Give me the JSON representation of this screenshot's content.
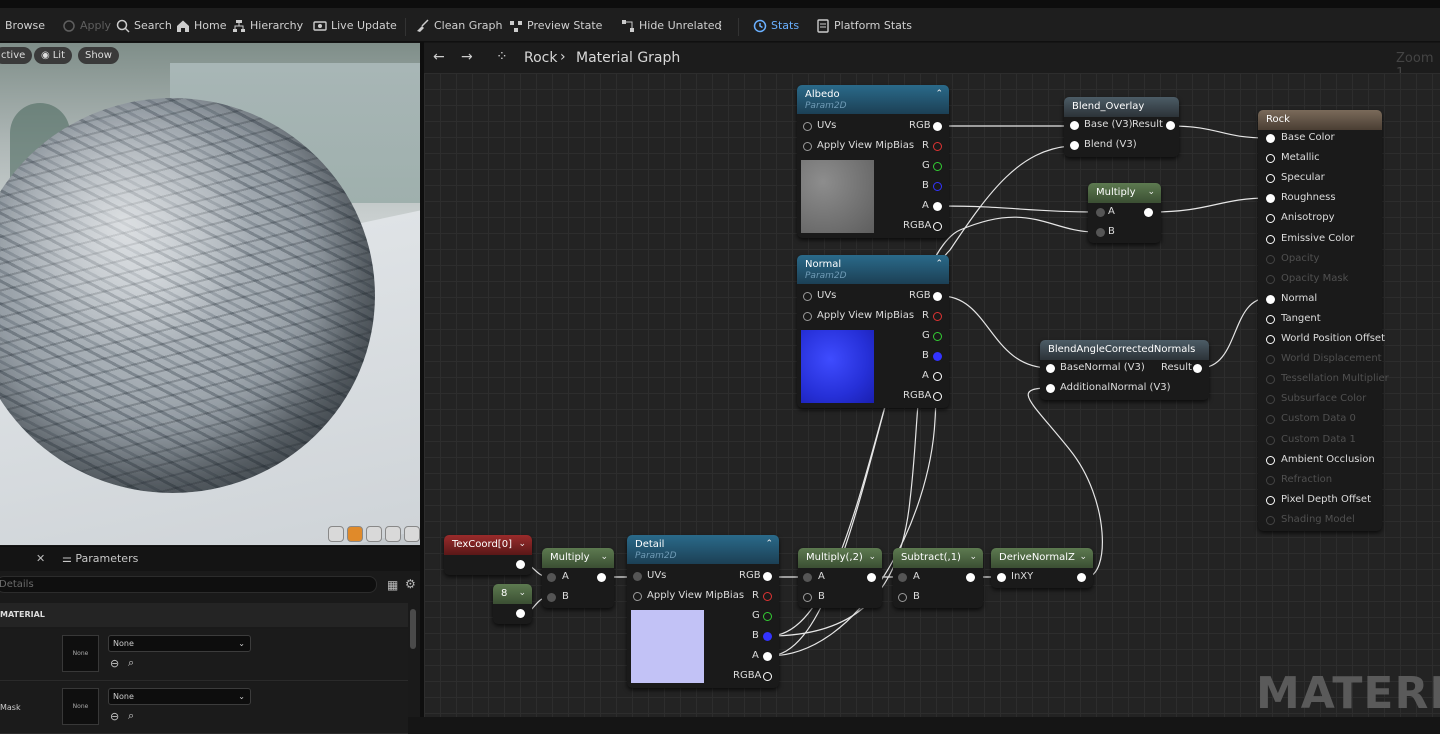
{
  "toolbar": {
    "items": [
      {
        "label": "Browse",
        "state": "normal"
      },
      {
        "label": "Apply",
        "state": "disabled"
      },
      {
        "label": "Search",
        "state": "normal"
      },
      {
        "label": "Home",
        "state": "normal"
      },
      {
        "label": "Hierarchy",
        "state": "normal"
      },
      {
        "label": "Live Update",
        "state": "normal"
      },
      {
        "label": "Clean Graph",
        "state": "normal"
      },
      {
        "label": "Preview State",
        "state": "normal"
      },
      {
        "label": "Hide Unrelated",
        "state": "normal"
      },
      {
        "label": "Stats",
        "state": "active"
      },
      {
        "label": "Platform Stats",
        "state": "normal"
      }
    ]
  },
  "viewport": {
    "chips": [
      "ctive",
      "Lit",
      "Show"
    ]
  },
  "details": {
    "tab_label": "Parameters",
    "search_placeholder": "Details",
    "category": "MATERIAL",
    "rows": [
      {
        "label": "",
        "thumb": "None",
        "value": "None"
      },
      {
        "label": "Mask",
        "thumb": "None",
        "value": "None"
      }
    ]
  },
  "graph": {
    "breadcrumb_root": "Rock",
    "breadcrumb_child": "Material Graph",
    "zoom_label": "Zoom 1",
    "watermark": "MATERIAL"
  },
  "nodes": {
    "albedo": {
      "title": "Albedo",
      "subtitle": "Param2D",
      "inputs": [
        "UVs",
        "Apply View MipBias"
      ],
      "outputs": [
        "RGB",
        "R",
        "G",
        "B",
        "A",
        "RGBA"
      ]
    },
    "normal": {
      "title": "Normal",
      "subtitle": "Param2D",
      "inputs": [
        "UVs",
        "Apply View MipBias"
      ],
      "outputs": [
        "RGB",
        "R",
        "G",
        "B",
        "A",
        "RGBA"
      ]
    },
    "detail": {
      "title": "Detail",
      "subtitle": "Param2D",
      "inputs": [
        "UVs",
        "Apply View MipBias"
      ],
      "outputs": [
        "RGB",
        "R",
        "G",
        "B",
        "A",
        "RGBA"
      ]
    },
    "blend_overlay": {
      "title": "Blend_Overlay",
      "inputs": [
        "Base (V3)",
        "Blend (V3)"
      ],
      "output": "Result"
    },
    "multiply_top": {
      "title": "Multiply",
      "inputs": [
        "A",
        "B"
      ]
    },
    "blend_angle": {
      "title": "BlendAngleCorrectedNormals",
      "inputs": [
        "BaseNormal (V3)",
        "AdditionalNormal (V3)"
      ],
      "output": "Result"
    },
    "texcoord": {
      "title": "TexCoord[0]"
    },
    "const_8": {
      "title": "8"
    },
    "multiply_low": {
      "title": "Multiply",
      "inputs": [
        "A",
        "B"
      ]
    },
    "multiply_2": {
      "title": "Multiply(,2)",
      "inputs": [
        "A",
        "B"
      ]
    },
    "subtract_1": {
      "title": "Subtract(,1)",
      "inputs": [
        "A",
        "B"
      ]
    },
    "derive_normalz": {
      "title": "DeriveNormalZ",
      "inputs": [
        "InXY"
      ]
    },
    "rock": {
      "title": "Rock",
      "inputs": [
        {
          "label": "Base Color",
          "enabled": true
        },
        {
          "label": "Metallic",
          "enabled": true
        },
        {
          "label": "Specular",
          "enabled": true
        },
        {
          "label": "Roughness",
          "enabled": true
        },
        {
          "label": "Anisotropy",
          "enabled": true
        },
        {
          "label": "Emissive Color",
          "enabled": true
        },
        {
          "label": "Opacity",
          "enabled": false
        },
        {
          "label": "Opacity Mask",
          "enabled": false
        },
        {
          "label": "Normal",
          "enabled": true
        },
        {
          "label": "Tangent",
          "enabled": true
        },
        {
          "label": "World Position Offset",
          "enabled": true
        },
        {
          "label": "World Displacement",
          "enabled": false
        },
        {
          "label": "Tessellation Multiplier",
          "enabled": false
        },
        {
          "label": "Subsurface Color",
          "enabled": false
        },
        {
          "label": "Custom Data 0",
          "enabled": false
        },
        {
          "label": "Custom Data 1",
          "enabled": false
        },
        {
          "label": "Ambient Occlusion",
          "enabled": true
        },
        {
          "label": "Refraction",
          "enabled": false
        },
        {
          "label": "Pixel Depth Offset",
          "enabled": true
        },
        {
          "label": "Shading Model",
          "enabled": false
        }
      ]
    }
  }
}
